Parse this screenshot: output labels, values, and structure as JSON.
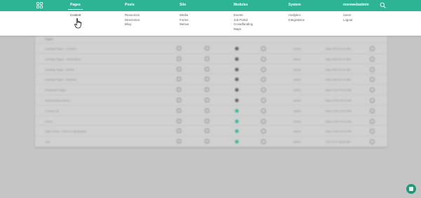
{
  "colors": {
    "nav_bg": "#2cb495",
    "accent_green": "#2cb495",
    "overlay_bg": "#c5c5c5"
  },
  "nav": {
    "grid_icon": "grid-icon",
    "items": [
      {
        "label": "Pages",
        "active": true
      },
      {
        "label": "Posts"
      },
      {
        "label": "Site"
      },
      {
        "label": "Modules"
      },
      {
        "label": "System"
      },
      {
        "label": "morewebadmin"
      }
    ],
    "search_icon": "search-icon"
  },
  "mega_menu": {
    "pages": [
      "Content"
    ],
    "posts": [
      "Resources",
      "Directories",
      "Blog"
    ],
    "site": [
      "Media",
      "Forms",
      "Menus"
    ],
    "modules": [
      "Events",
      "Job Portal",
      "Crowdfunding",
      "Maps"
    ],
    "system": [
      "Analytics",
      "Integrations"
    ],
    "account": [
      "Users",
      "Logout"
    ]
  },
  "table": {
    "header": "Pages",
    "rows": [
      {
        "name": "Landing Pages - Content",
        "user": "admin",
        "date": "May 2023 01:10 AM",
        "toggle": "dark"
      },
      {
        "name": "Landing Pages - Subscribers",
        "user": "admin",
        "date": "May 2023 01:10 AM",
        "toggle": "dark"
      },
      {
        "name": "Landing Pages - Mobile",
        "user": "admin",
        "date": "May 2023 01:10 AM",
        "toggle": "dark"
      },
      {
        "name": "Landing Pages - Modules",
        "user": "admin",
        "date": "May 2023 01:10 AM",
        "toggle": "dark"
      },
      {
        "name": "Response Pages",
        "user": "admin",
        "date": "May 13:05 10:10 AM",
        "toggle": "dark"
      },
      {
        "name": "Subscriptions Demo",
        "user": "admin",
        "date": "May 13:05 10:10 AM",
        "toggle": "dark"
      },
      {
        "name": "Contact Us",
        "user": "admin",
        "date": "May 13:05 10:10 AM",
        "toggle": "green"
      },
      {
        "name": "Home",
        "user": "admin",
        "date": "May 13:05 10:10 AM",
        "toggle": "green"
      },
      {
        "name": "Style Guide - Color & Typography",
        "user": "admin",
        "date": "May 13:05 10:10 AM",
        "toggle": "green"
      },
      {
        "name": "Test",
        "user": "admin",
        "date": "Oct 10:10 08:20 AM",
        "toggle": "green"
      }
    ]
  },
  "chat_icon": "chat-icon"
}
